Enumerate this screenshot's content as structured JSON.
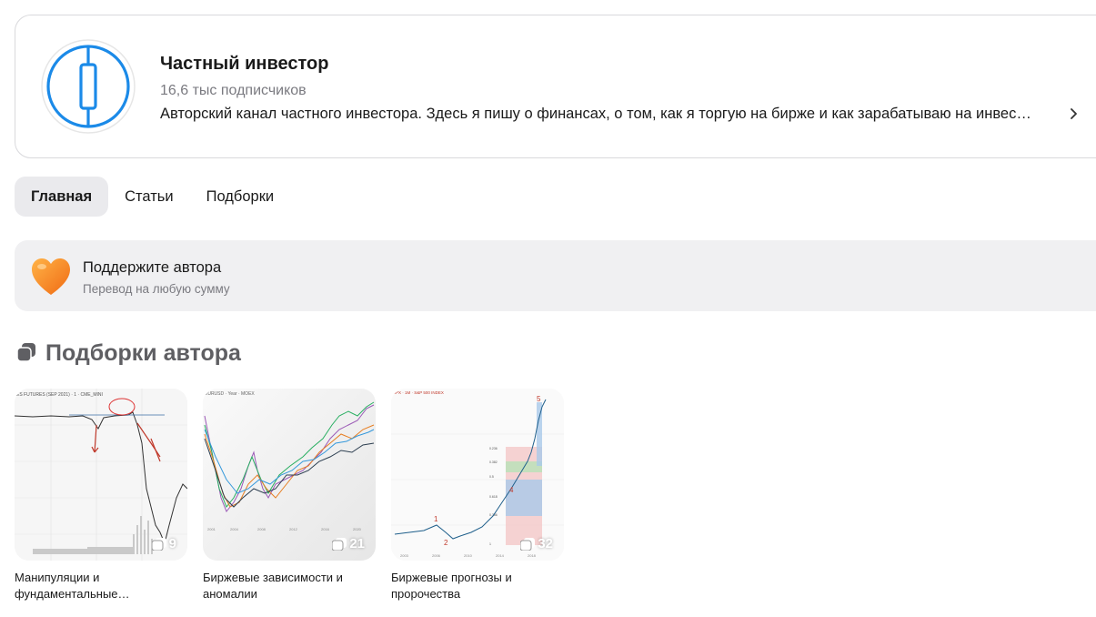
{
  "channel": {
    "name": "Частный инвестор",
    "subscribers": "16,6 тыс подписчиков",
    "description": "Авторский канал частного инвестора. Здесь я пишу о финансах, о том, как я торгую на бирже и как зарабатываю на инвес…",
    "accent_color": "#1b8ae8"
  },
  "tabs": [
    {
      "label": "Главная",
      "active": true
    },
    {
      "label": "Статьи",
      "active": false
    },
    {
      "label": "Подборки",
      "active": false
    }
  ],
  "support": {
    "title": "Поддержите автора",
    "subtitle": "Перевод на любую сумму",
    "icon": "heart-icon"
  },
  "collections_section": {
    "title": "Подборки автора",
    "icon": "stack-icon",
    "items": [
      {
        "label": "Манипуляции и фундаментальные…",
        "count": "9"
      },
      {
        "label": "Биржевые зависимости и аномалии",
        "count": "21"
      },
      {
        "label": "Биржевые прогнозы и пророчества",
        "count": "32"
      }
    ]
  }
}
